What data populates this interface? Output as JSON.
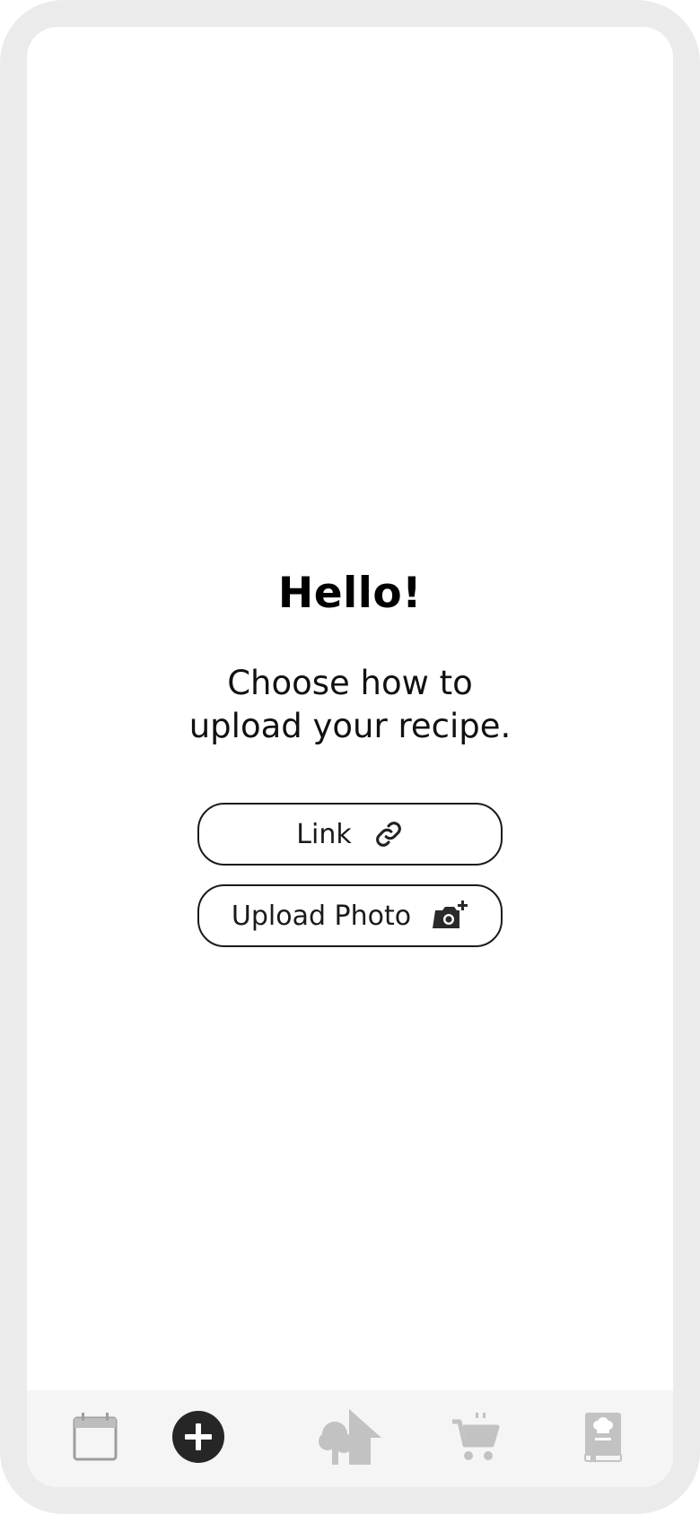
{
  "main": {
    "title": "Hello!",
    "subtitle_line1": "Choose how to",
    "subtitle_line2": "upload your recipe."
  },
  "buttons": {
    "link_label": "Link",
    "upload_photo_label": "Upload Photo"
  },
  "tabbar": {
    "items": [
      {
        "icon": "calendar-icon"
      },
      {
        "icon": "add-icon",
        "active": true
      },
      {
        "icon": "tree-house-icon"
      },
      {
        "icon": "cart-icon"
      },
      {
        "icon": "cookbook-icon"
      }
    ]
  },
  "colors": {
    "frame": "#ebebeb",
    "tabbar_bg": "#f5f5f5",
    "icon_inactive": "#bdbdbd",
    "icon_active": "#262626"
  }
}
